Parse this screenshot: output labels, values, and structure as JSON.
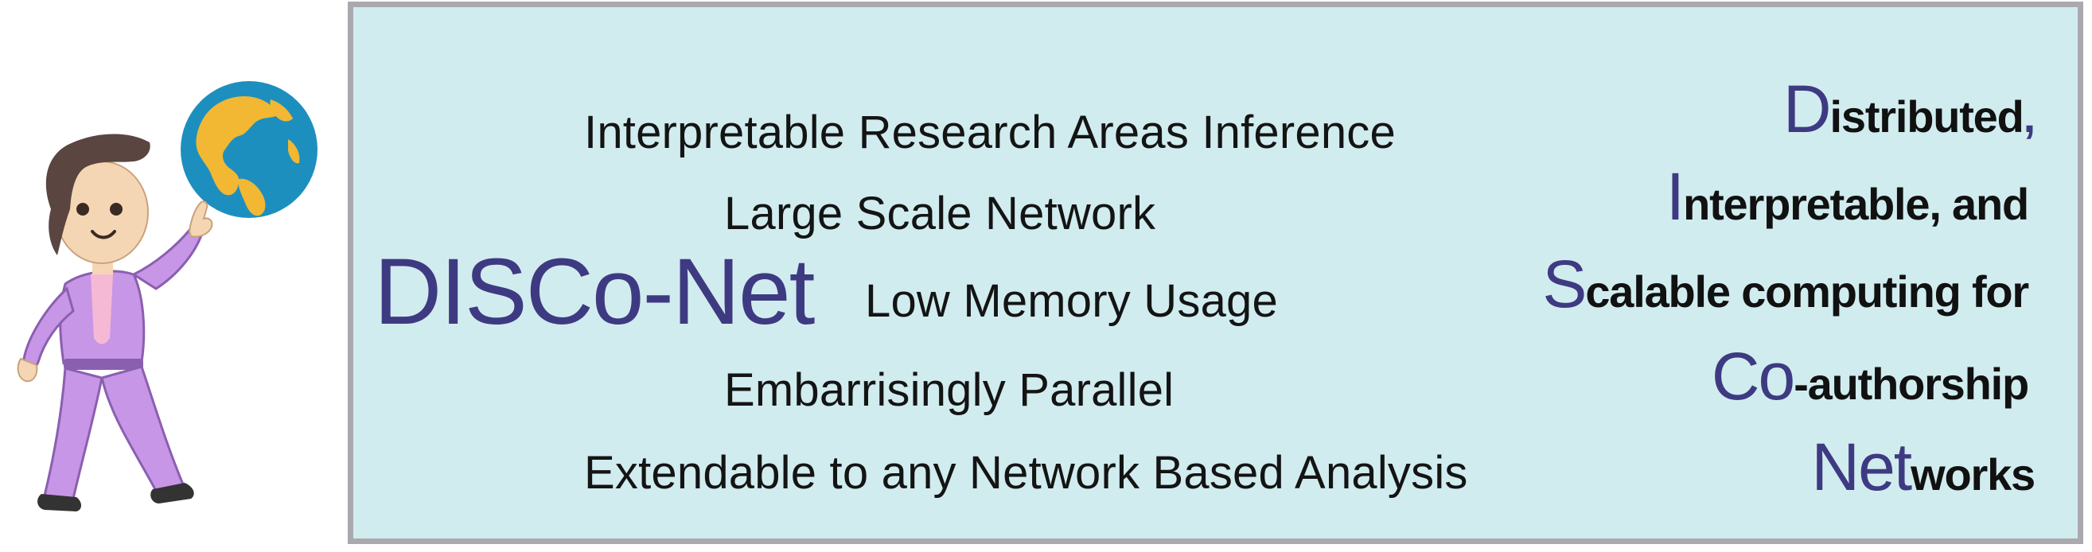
{
  "title": "DISCo-Net",
  "features": [
    "Interpretable Research Areas Inference",
    "Large Scale Network",
    "Low Memory Usage",
    "Embarrisingly Parallel",
    "Extendable to any Network Based Analysis"
  ],
  "acronym": {
    "line1": {
      "cap": "D",
      "rest": "istributed",
      "comma": ","
    },
    "line2": {
      "cap": "I",
      "rest": "nterpretable, and"
    },
    "line3": {
      "cap": "S",
      "rest": "calable computing for"
    },
    "line4": {
      "cap": "Co",
      "rest": "-authorship"
    },
    "line5": {
      "cap": "Net",
      "rest": "works"
    }
  },
  "colors": {
    "panel_background": "#d1ecee",
    "panel_border": "#a9a9ae",
    "accent": "#3e3a82",
    "text": "#141414",
    "mascot_suit": "#c896e6",
    "globe_ocean": "#1d8fbf",
    "globe_land": "#f2b733"
  },
  "icons": {
    "mascot": "dancing-man-pointing-icon",
    "globe": "globe-icon"
  }
}
